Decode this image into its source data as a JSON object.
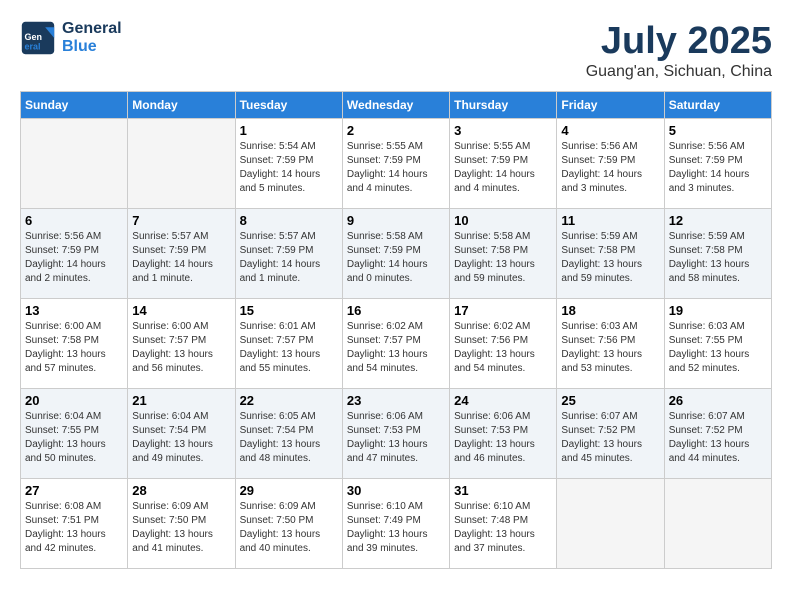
{
  "header": {
    "logo_line1": "General",
    "logo_line2": "Blue",
    "month": "July 2025",
    "location": "Guang'an, Sichuan, China"
  },
  "days_of_week": [
    "Sunday",
    "Monday",
    "Tuesday",
    "Wednesday",
    "Thursday",
    "Friday",
    "Saturday"
  ],
  "weeks": [
    [
      {
        "day": "",
        "info": ""
      },
      {
        "day": "",
        "info": ""
      },
      {
        "day": "1",
        "info": "Sunrise: 5:54 AM\nSunset: 7:59 PM\nDaylight: 14 hours\nand 5 minutes."
      },
      {
        "day": "2",
        "info": "Sunrise: 5:55 AM\nSunset: 7:59 PM\nDaylight: 14 hours\nand 4 minutes."
      },
      {
        "day": "3",
        "info": "Sunrise: 5:55 AM\nSunset: 7:59 PM\nDaylight: 14 hours\nand 4 minutes."
      },
      {
        "day": "4",
        "info": "Sunrise: 5:56 AM\nSunset: 7:59 PM\nDaylight: 14 hours\nand 3 minutes."
      },
      {
        "day": "5",
        "info": "Sunrise: 5:56 AM\nSunset: 7:59 PM\nDaylight: 14 hours\nand 3 minutes."
      }
    ],
    [
      {
        "day": "6",
        "info": "Sunrise: 5:56 AM\nSunset: 7:59 PM\nDaylight: 14 hours\nand 2 minutes."
      },
      {
        "day": "7",
        "info": "Sunrise: 5:57 AM\nSunset: 7:59 PM\nDaylight: 14 hours\nand 1 minute."
      },
      {
        "day": "8",
        "info": "Sunrise: 5:57 AM\nSunset: 7:59 PM\nDaylight: 14 hours\nand 1 minute."
      },
      {
        "day": "9",
        "info": "Sunrise: 5:58 AM\nSunset: 7:59 PM\nDaylight: 14 hours\nand 0 minutes."
      },
      {
        "day": "10",
        "info": "Sunrise: 5:58 AM\nSunset: 7:58 PM\nDaylight: 13 hours\nand 59 minutes."
      },
      {
        "day": "11",
        "info": "Sunrise: 5:59 AM\nSunset: 7:58 PM\nDaylight: 13 hours\nand 59 minutes."
      },
      {
        "day": "12",
        "info": "Sunrise: 5:59 AM\nSunset: 7:58 PM\nDaylight: 13 hours\nand 58 minutes."
      }
    ],
    [
      {
        "day": "13",
        "info": "Sunrise: 6:00 AM\nSunset: 7:58 PM\nDaylight: 13 hours\nand 57 minutes."
      },
      {
        "day": "14",
        "info": "Sunrise: 6:00 AM\nSunset: 7:57 PM\nDaylight: 13 hours\nand 56 minutes."
      },
      {
        "day": "15",
        "info": "Sunrise: 6:01 AM\nSunset: 7:57 PM\nDaylight: 13 hours\nand 55 minutes."
      },
      {
        "day": "16",
        "info": "Sunrise: 6:02 AM\nSunset: 7:57 PM\nDaylight: 13 hours\nand 54 minutes."
      },
      {
        "day": "17",
        "info": "Sunrise: 6:02 AM\nSunset: 7:56 PM\nDaylight: 13 hours\nand 54 minutes."
      },
      {
        "day": "18",
        "info": "Sunrise: 6:03 AM\nSunset: 7:56 PM\nDaylight: 13 hours\nand 53 minutes."
      },
      {
        "day": "19",
        "info": "Sunrise: 6:03 AM\nSunset: 7:55 PM\nDaylight: 13 hours\nand 52 minutes."
      }
    ],
    [
      {
        "day": "20",
        "info": "Sunrise: 6:04 AM\nSunset: 7:55 PM\nDaylight: 13 hours\nand 50 minutes."
      },
      {
        "day": "21",
        "info": "Sunrise: 6:04 AM\nSunset: 7:54 PM\nDaylight: 13 hours\nand 49 minutes."
      },
      {
        "day": "22",
        "info": "Sunrise: 6:05 AM\nSunset: 7:54 PM\nDaylight: 13 hours\nand 48 minutes."
      },
      {
        "day": "23",
        "info": "Sunrise: 6:06 AM\nSunset: 7:53 PM\nDaylight: 13 hours\nand 47 minutes."
      },
      {
        "day": "24",
        "info": "Sunrise: 6:06 AM\nSunset: 7:53 PM\nDaylight: 13 hours\nand 46 minutes."
      },
      {
        "day": "25",
        "info": "Sunrise: 6:07 AM\nSunset: 7:52 PM\nDaylight: 13 hours\nand 45 minutes."
      },
      {
        "day": "26",
        "info": "Sunrise: 6:07 AM\nSunset: 7:52 PM\nDaylight: 13 hours\nand 44 minutes."
      }
    ],
    [
      {
        "day": "27",
        "info": "Sunrise: 6:08 AM\nSunset: 7:51 PM\nDaylight: 13 hours\nand 42 minutes."
      },
      {
        "day": "28",
        "info": "Sunrise: 6:09 AM\nSunset: 7:50 PM\nDaylight: 13 hours\nand 41 minutes."
      },
      {
        "day": "29",
        "info": "Sunrise: 6:09 AM\nSunset: 7:50 PM\nDaylight: 13 hours\nand 40 minutes."
      },
      {
        "day": "30",
        "info": "Sunrise: 6:10 AM\nSunset: 7:49 PM\nDaylight: 13 hours\nand 39 minutes."
      },
      {
        "day": "31",
        "info": "Sunrise: 6:10 AM\nSunset: 7:48 PM\nDaylight: 13 hours\nand 37 minutes."
      },
      {
        "day": "",
        "info": ""
      },
      {
        "day": "",
        "info": ""
      }
    ]
  ]
}
